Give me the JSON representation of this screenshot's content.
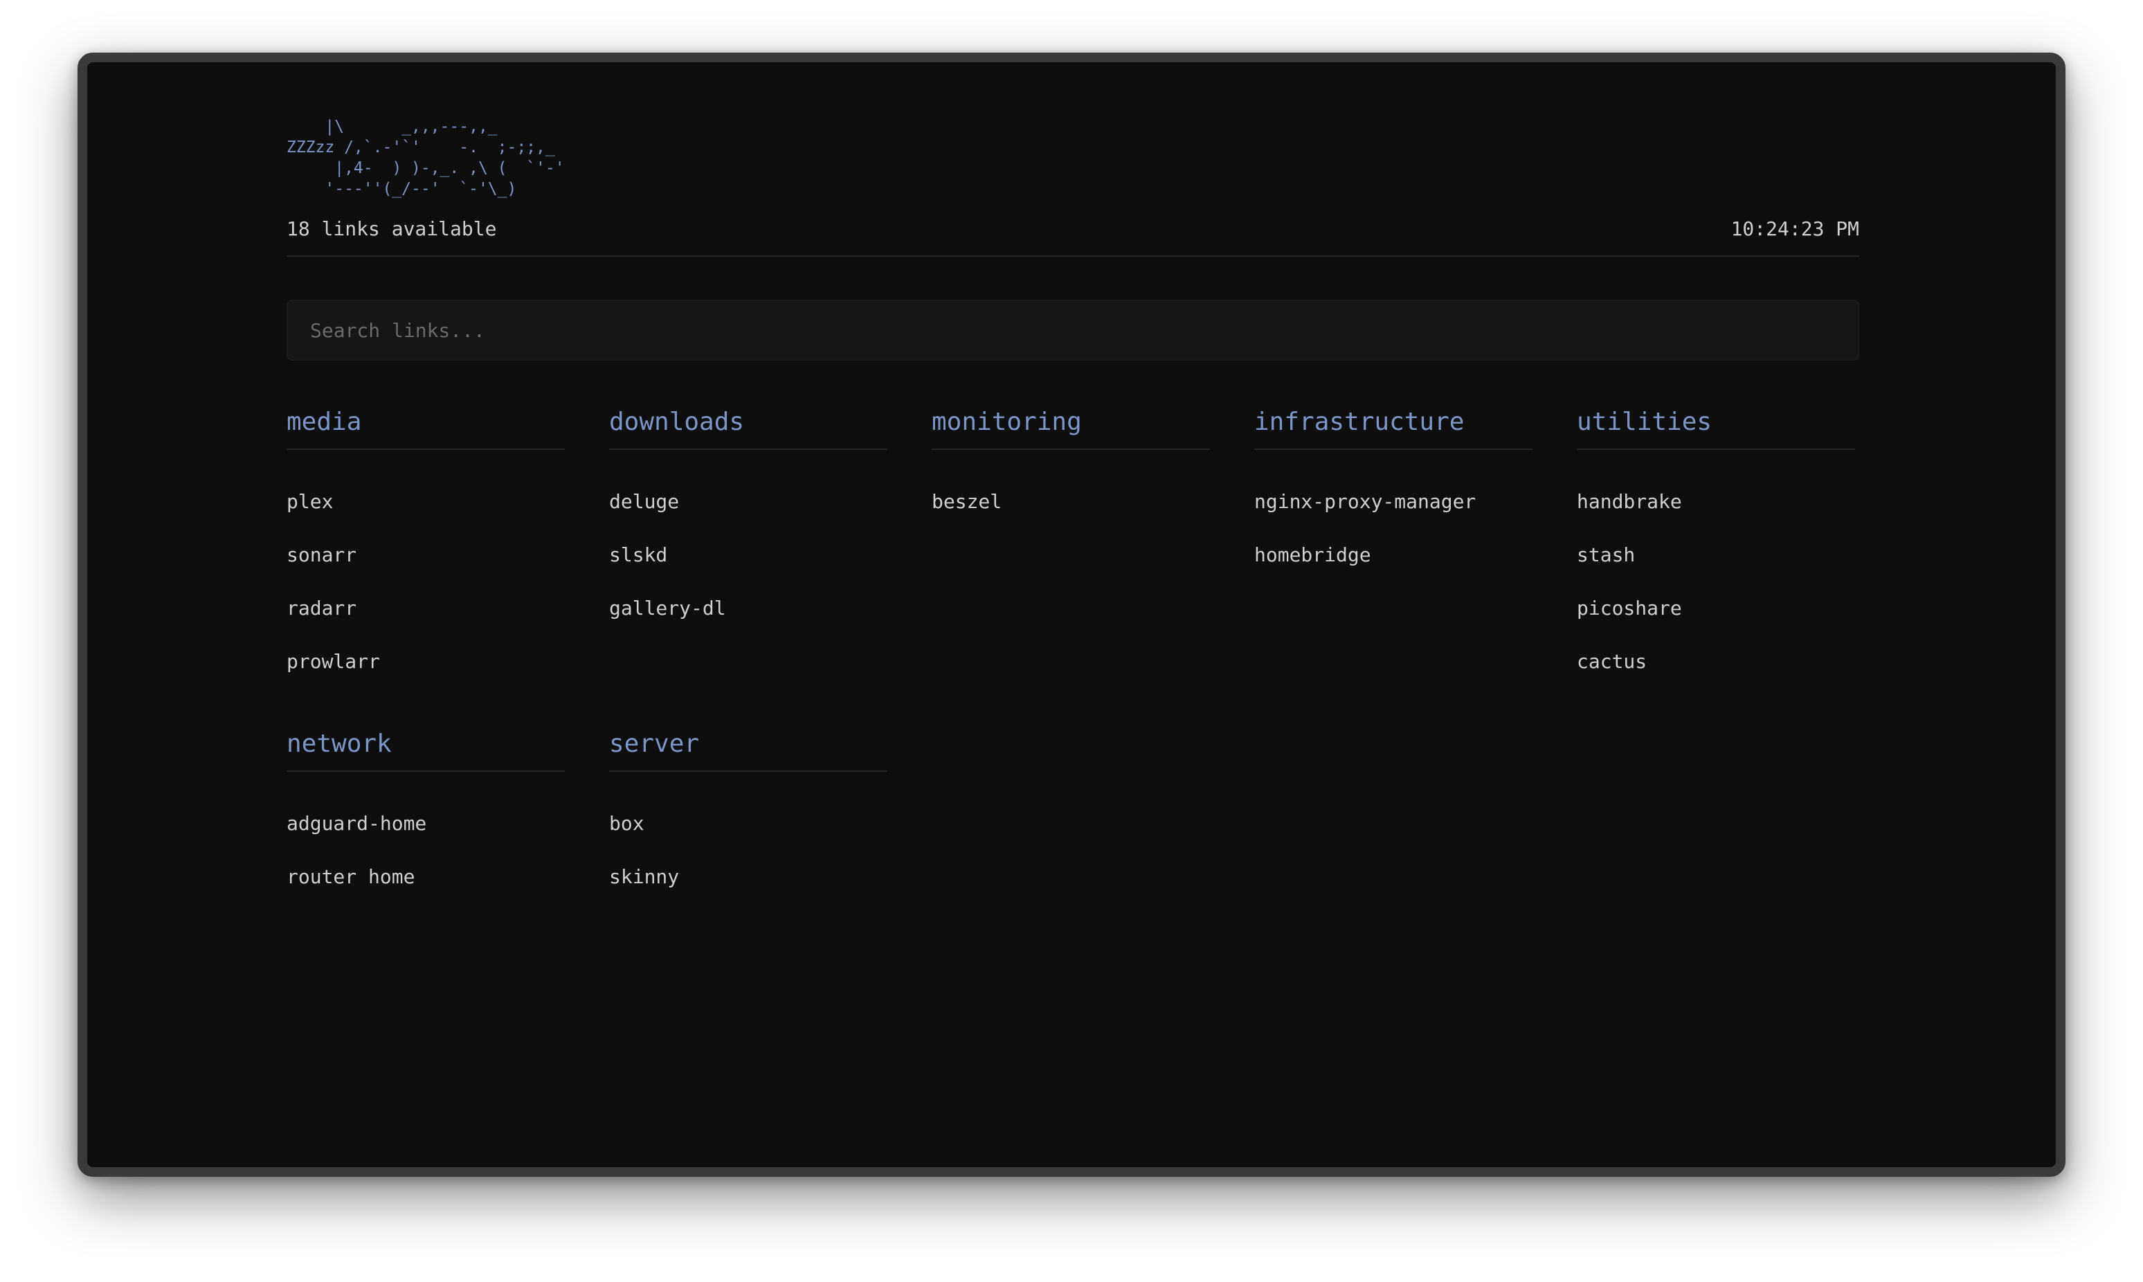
{
  "header": {
    "ascii_art": "    |\\      _,,,---,,_\nZZZzz /,`.-'`'    -.  ;-;;,_\n     |,4-  ) )-,_. ,\\ (  `'-'\n    '---''(_/--'  `-'\\_)",
    "links_count": "18 links available",
    "clock": "10:24:23 PM"
  },
  "search": {
    "placeholder": "Search links...",
    "value": ""
  },
  "colors": {
    "background": "#0e0e0e",
    "accent": "#7d95c6",
    "text": "#cfcfcf",
    "divider": "#262626"
  },
  "categories": [
    {
      "title": "media",
      "links": [
        "plex",
        "sonarr",
        "radarr",
        "prowlarr"
      ]
    },
    {
      "title": "downloads",
      "links": [
        "deluge",
        "slskd",
        "gallery-dl"
      ]
    },
    {
      "title": "monitoring",
      "links": [
        "beszel"
      ]
    },
    {
      "title": "infrastructure",
      "links": [
        "nginx-proxy-manager",
        "homebridge"
      ]
    },
    {
      "title": "utilities",
      "links": [
        "handbrake",
        "stash",
        "picoshare",
        "cactus"
      ]
    },
    {
      "title": "network",
      "links": [
        "adguard-home",
        "router home"
      ]
    },
    {
      "title": "server",
      "links": [
        "box",
        "skinny"
      ]
    }
  ]
}
